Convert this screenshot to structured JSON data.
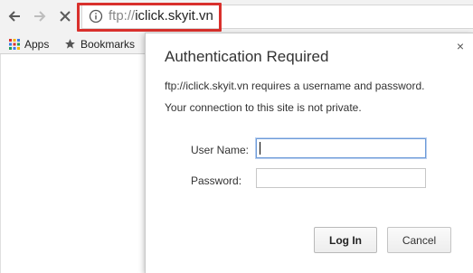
{
  "browser": {
    "url_scheme": "ftp://",
    "url_host": "iclick.skyit.vn"
  },
  "bookmarks_bar": {
    "items": [
      {
        "label": "Apps",
        "icon": "apps-grid-icon"
      },
      {
        "label": "Bookmarks",
        "icon": "star-icon"
      }
    ]
  },
  "dialog": {
    "title": "Authentication Required",
    "message": "ftp://iclick.skyit.vn requires a username and password.",
    "privacy_notice": "Your connection to this site is not private.",
    "close_label": "×",
    "username_label": "User Name:",
    "username_value": "",
    "password_label": "Password:",
    "password_value": "",
    "login_label": "Log In",
    "cancel_label": "Cancel"
  },
  "colors": {
    "highlight": "#d9302c",
    "toolbar_bg": "#f2f2f2"
  }
}
